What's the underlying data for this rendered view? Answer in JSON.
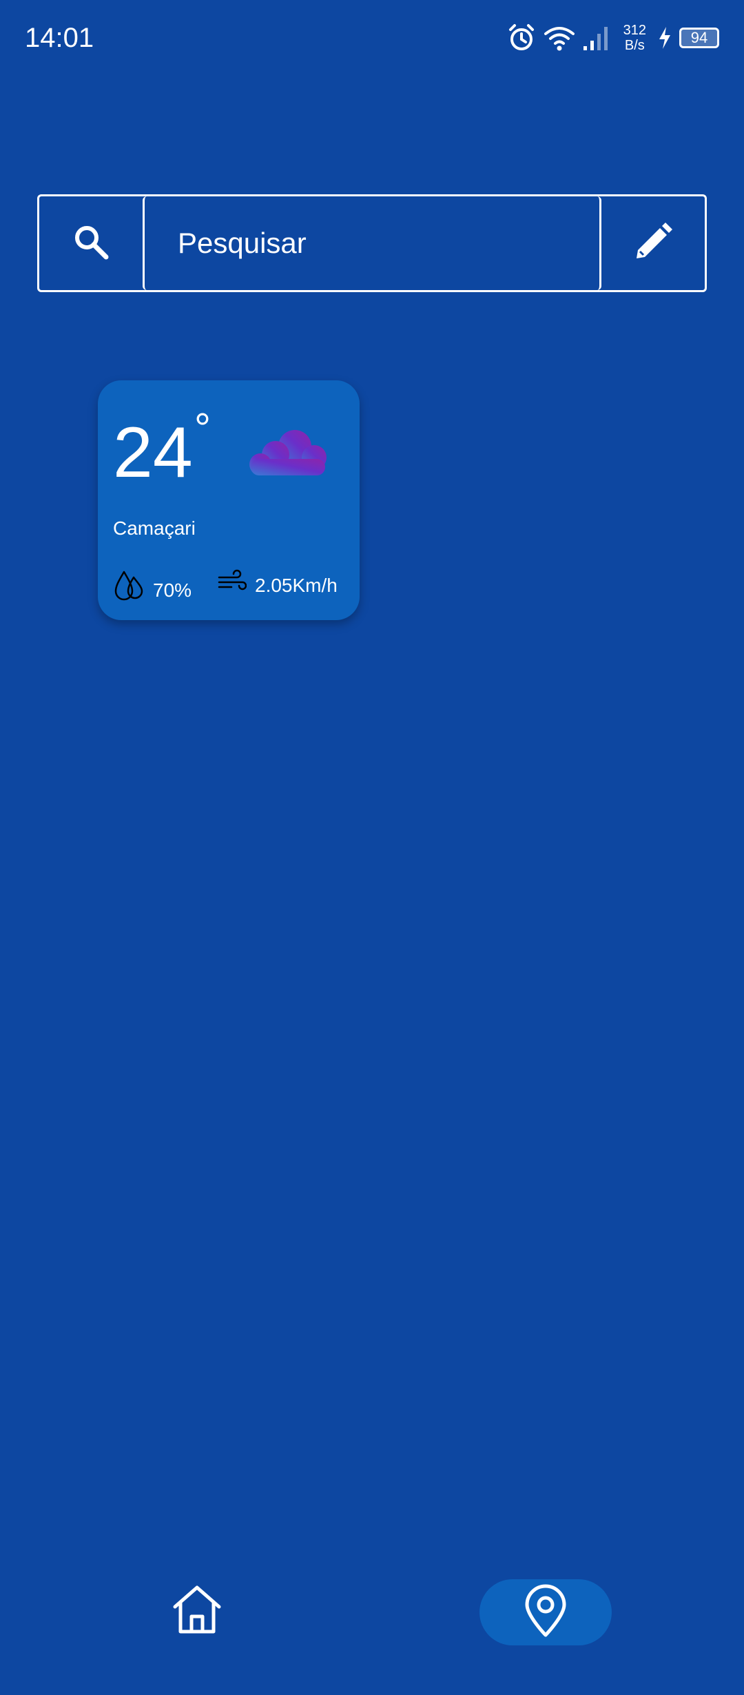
{
  "status_bar": {
    "time": "14:01",
    "net_speed_value": "312",
    "net_speed_unit": "B/s",
    "battery": "94",
    "icons": [
      "alarm-icon",
      "wifi-icon",
      "signal-icon",
      "charging-icon",
      "battery-icon"
    ]
  },
  "search": {
    "placeholder": "Pesquisar",
    "search_icon": "search-icon",
    "edit_icon": "pencil-icon"
  },
  "weather_card": {
    "temperature": "24",
    "degree_symbol": "°",
    "city": "Camaçari",
    "humidity": "70%",
    "wind": "2.05Km/h",
    "condition_icon": "cloud-icon",
    "humidity_icon": "droplets-icon",
    "wind_icon": "wind-icon"
  },
  "bottom_nav": {
    "items": [
      {
        "icon": "home-icon",
        "active": false
      },
      {
        "icon": "location-pin-icon",
        "active": true
      }
    ]
  },
  "colors": {
    "background": "#0d47a1",
    "card": "#0d63bd",
    "active_nav": "#0d63bd",
    "text": "#ffffff"
  }
}
